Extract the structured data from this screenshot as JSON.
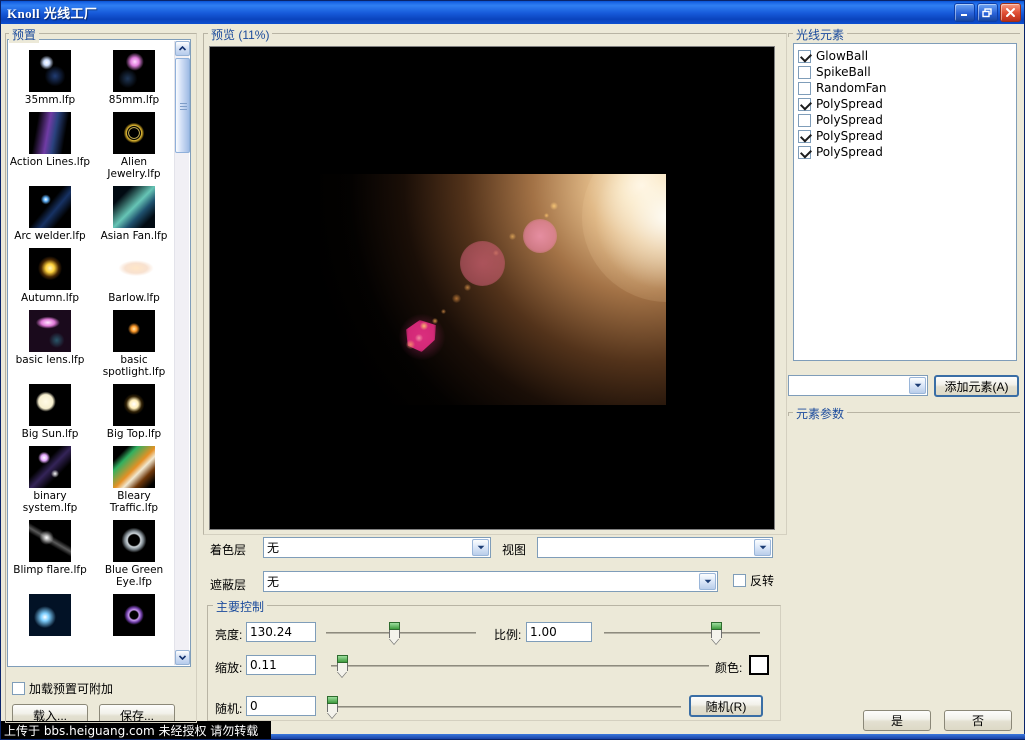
{
  "window": {
    "title": "Knoll  光线工厂",
    "minimize_icon": "minimize-icon",
    "restore_icon": "restore-icon",
    "close_icon": "close-icon"
  },
  "preset_panel": {
    "group_label": "预置",
    "scroll_up_icon": "chevron-up-icon",
    "scroll_down_icon": "chevron-down-icon",
    "presets": [
      {
        "name": "35mm.lfp",
        "thumb": "flare-white-blue"
      },
      {
        "name": "85mm.lfp",
        "thumb": "flare-magenta"
      },
      {
        "name": "Action Lines.lfp",
        "thumb": "streak-purple"
      },
      {
        "name": "Alien Jewelry.lfp",
        "thumb": "ring-gold"
      },
      {
        "name": "Arc welder.lfp",
        "thumb": "spark-blue"
      },
      {
        "name": "Asian Fan.lfp",
        "thumb": "fan-teal"
      },
      {
        "name": "Autumn.lfp",
        "thumb": "star-yellow"
      },
      {
        "name": "Barlow.lfp",
        "thumb": "smear-cream"
      },
      {
        "name": "basic lens.lfp",
        "thumb": "lens-pink"
      },
      {
        "name": "basic spotlight.lfp",
        "thumb": "spot-orange"
      },
      {
        "name": "Big Sun.lfp",
        "thumb": "disc-cream"
      },
      {
        "name": "Big Top.lfp",
        "thumb": "glow-white"
      },
      {
        "name": "binary system.lfp",
        "thumb": "binary-violet"
      },
      {
        "name": "Bleary Traffic.lfp",
        "thumb": "streak-orange"
      },
      {
        "name": "Blimp flare.lfp",
        "thumb": "burst-white"
      },
      {
        "name": "Blue Green Eye.lfp",
        "thumb": "eye-dark"
      },
      {
        "name": "",
        "thumb": "cut-blue"
      },
      {
        "name": "",
        "thumb": "cut-purple"
      }
    ],
    "append_checkbox": {
      "label": "加载预置可附加",
      "checked": false
    },
    "load_button": "载入...",
    "save_button": "保存..."
  },
  "preview": {
    "group_label": "预览 (11%)",
    "zoom_percent": "11%"
  },
  "elements_panel": {
    "group_label": "光线元素",
    "items": [
      {
        "label": "GlowBall",
        "checked": true
      },
      {
        "label": "SpikeBall",
        "checked": false
      },
      {
        "label": "RandomFan",
        "checked": false
      },
      {
        "label": "PolySpread",
        "checked": true
      },
      {
        "label": "PolySpread",
        "checked": false
      },
      {
        "label": "PolySpread",
        "checked": true
      },
      {
        "label": "PolySpread",
        "checked": true
      }
    ],
    "add_combo_value": "",
    "add_combo_arrow_icon": "chevron-down-icon",
    "add_button": "添加元素(A)",
    "params_group_label": "元素参数"
  },
  "layers": {
    "colorize_label": "着色层",
    "colorize_value": "无",
    "colorize_arrow_icon": "chevron-down-icon",
    "view_label": "视图",
    "view_value": "",
    "view_arrow_icon": "chevron-down-icon",
    "obscure_label": "遮蔽层",
    "obscure_value": "无",
    "obscure_arrow_icon": "chevron-down-icon",
    "invert_label": "反转",
    "invert_checked": false
  },
  "main_controls": {
    "group_label": "主要控制",
    "brightness_label": "亮度:",
    "brightness_value": "130.24",
    "brightness_slider_pct": 45,
    "ratio_label": "比例:",
    "ratio_value": "1.00",
    "ratio_slider_pct": 72,
    "zoom_label": "缩放:",
    "zoom_value": "0.11",
    "zoom_slider_pct": 3,
    "color_label": "颜色:",
    "color_swatch": "#ffffff",
    "random_label": "随机:",
    "random_value": "0",
    "random_slider_pct": 1,
    "random_button": "随机(R)"
  },
  "dialog_buttons": {
    "ok_label": "是",
    "cancel_label": "否"
  },
  "watermark": {
    "text": "上传于 bbs.heiguang.com  未经授权  请勿转载"
  }
}
